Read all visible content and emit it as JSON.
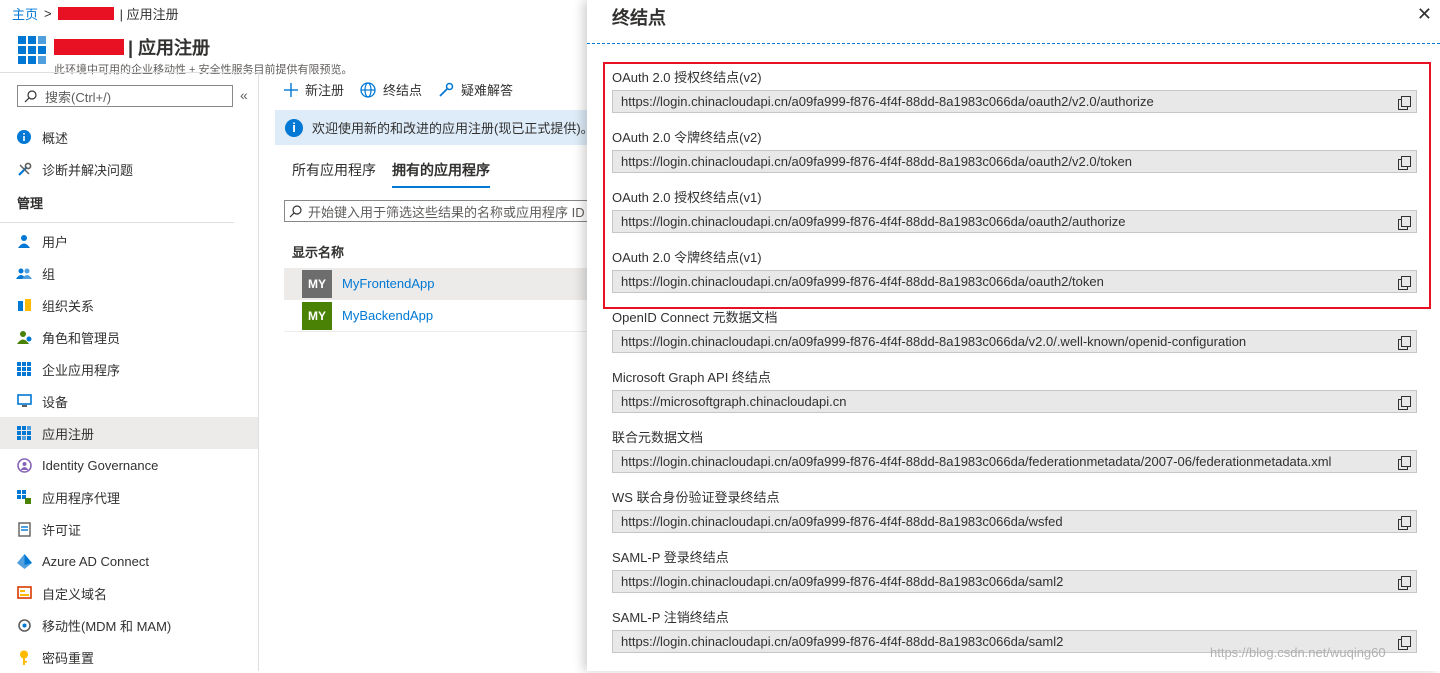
{
  "breadcrumb": {
    "home": "主页",
    "separator": ">",
    "current": "| 应用注册"
  },
  "header": {
    "title": "| 应用注册",
    "subtitle": "此环境中可用的企业移动性 + 安全性服务目前提供有限预览。"
  },
  "sidebar": {
    "search_placeholder": "搜索(Ctrl+/)",
    "collapse": "«",
    "top_items": [
      {
        "label": "概述",
        "icon": "info-icon"
      },
      {
        "label": "诊断并解决问题",
        "icon": "wrench-icon"
      }
    ],
    "section": "管理",
    "items": [
      {
        "label": "用户",
        "icon": "user-icon"
      },
      {
        "label": "组",
        "icon": "group-icon"
      },
      {
        "label": "组织关系",
        "icon": "org-icon"
      },
      {
        "label": "角色和管理员",
        "icon": "roles-icon"
      },
      {
        "label": "企业应用程序",
        "icon": "enterprise-apps-icon"
      },
      {
        "label": "设备",
        "icon": "device-icon"
      },
      {
        "label": "应用注册",
        "icon": "app-registrations-icon",
        "active": true
      },
      {
        "label": "Identity Governance",
        "icon": "identity-governance-icon"
      },
      {
        "label": "应用程序代理",
        "icon": "app-proxy-icon"
      },
      {
        "label": "许可证",
        "icon": "license-icon"
      },
      {
        "label": "Azure AD Connect",
        "icon": "azure-ad-connect-icon"
      },
      {
        "label": "自定义域名",
        "icon": "domain-icon"
      },
      {
        "label": "移动性(MDM 和 MAM)",
        "icon": "mobility-icon"
      },
      {
        "label": "密码重置",
        "icon": "key-icon"
      }
    ]
  },
  "toolbar": {
    "new_registration": "新注册",
    "endpoints": "终结点",
    "troubleshoot": "疑难解答"
  },
  "info_bar": {
    "text": "欢迎使用新的和改进的应用注册(现已正式提供)。查"
  },
  "tabs": [
    {
      "label": "所有应用程序",
      "active": false
    },
    {
      "label": "拥有的应用程序",
      "active": true
    }
  ],
  "filter_placeholder": "开始键入用于筛选这些结果的名称或应用程序 ID",
  "table": {
    "column": "显示名称",
    "rows": [
      {
        "initials": "MY",
        "name": "MyFrontendApp",
        "color": "#6d6d6d"
      },
      {
        "initials": "MY",
        "name": "MyBackendApp",
        "color": "#498205"
      }
    ]
  },
  "panel": {
    "title": "终结点",
    "close": "✕",
    "endpoints": [
      {
        "label": "OAuth 2.0 授权终结点(v2)",
        "value": "https://login.chinacloudapi.cn/a09fa999-f876-4f4f-88dd-8a1983c066da/oauth2/v2.0/authorize"
      },
      {
        "label": "OAuth 2.0 令牌终结点(v2)",
        "value": "https://login.chinacloudapi.cn/a09fa999-f876-4f4f-88dd-8a1983c066da/oauth2/v2.0/token"
      },
      {
        "label": "OAuth 2.0 授权终结点(v1)",
        "value": "https://login.chinacloudapi.cn/a09fa999-f876-4f4f-88dd-8a1983c066da/oauth2/authorize"
      },
      {
        "label": "OAuth 2.0 令牌终结点(v1)",
        "value": "https://login.chinacloudapi.cn/a09fa999-f876-4f4f-88dd-8a1983c066da/oauth2/token"
      },
      {
        "label": "OpenID Connect 元数据文档",
        "value": "https://login.chinacloudapi.cn/a09fa999-f876-4f4f-88dd-8a1983c066da/v2.0/.well-known/openid-configuration"
      },
      {
        "label": "Microsoft Graph API 终结点",
        "value": "https://microsoftgraph.chinacloudapi.cn"
      },
      {
        "label": "联合元数据文档",
        "value": "https://login.chinacloudapi.cn/a09fa999-f876-4f4f-88dd-8a1983c066da/federationmetadata/2007-06/federationmetadata.xml"
      },
      {
        "label": "WS 联合身份验证登录终结点",
        "value": "https://login.chinacloudapi.cn/a09fa999-f876-4f4f-88dd-8a1983c066da/wsfed"
      },
      {
        "label": "SAML-P 登录终结点",
        "value": "https://login.chinacloudapi.cn/a09fa999-f876-4f4f-88dd-8a1983c066da/saml2"
      },
      {
        "label": "SAML-P 注销终结点",
        "value": "https://login.chinacloudapi.cn/a09fa999-f876-4f4f-88dd-8a1983c066da/saml2"
      }
    ]
  },
  "watermark": "https://blog.csdn.net/wuqing60",
  "colors": {
    "accent": "#0078d4",
    "highlight": "#e81123",
    "info_bg": "#deecf9",
    "redaction": "#e81123"
  }
}
